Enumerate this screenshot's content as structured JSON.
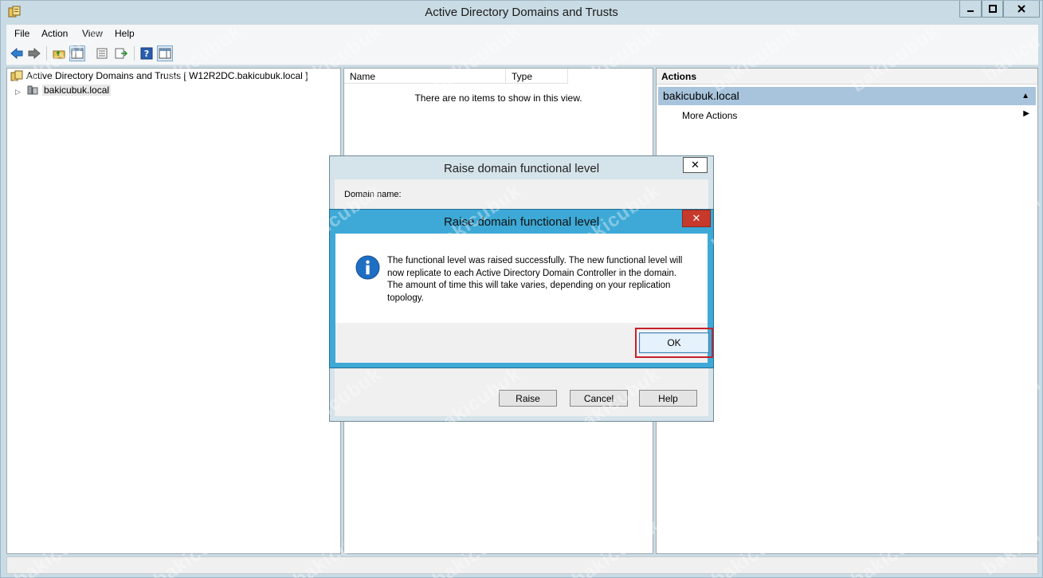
{
  "window": {
    "title": "Active Directory Domains and Trusts"
  },
  "menu": {
    "items": [
      "File",
      "Action",
      "View",
      "Help"
    ]
  },
  "tree": {
    "root_label": "Active Directory Domains and Trusts [ W12R2DC.bakicubuk.local ]",
    "domain_label": "bakicubuk.local"
  },
  "list": {
    "columns": [
      "Name",
      "Type"
    ],
    "empty_message": "There are no items to show in this view."
  },
  "actions": {
    "title": "Actions",
    "group": "bakicubuk.local",
    "item": "More Actions"
  },
  "back_dialog": {
    "title": "Raise domain functional level",
    "close_glyph": "✕",
    "domain_name_label": "Domain name:",
    "buttons": [
      "Raise",
      "Cancel",
      "Help"
    ]
  },
  "message_box": {
    "title": "Raise domain functional level",
    "close_glyph": "✕",
    "message": "The functional level was raised successfully. The new functional level will now replicate to each Active Directory Domain Controller in the domain. The amount of time this will take varies, depending on your replication topology.",
    "ok_label": "OK",
    "icon": "info-icon"
  },
  "watermark": "bakicubuk",
  "colors": {
    "frame": "#c9dbe4",
    "msgbox_border": "#3ea9d6",
    "close_red": "#c7392b",
    "highlight_red": "#c8202a",
    "actions_group": "#a8c4dc"
  }
}
